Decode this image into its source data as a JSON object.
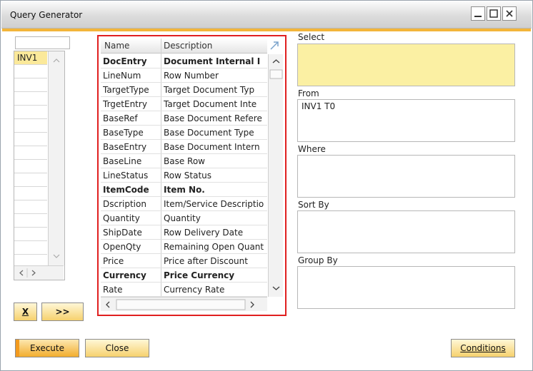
{
  "window": {
    "title": "Query Generator"
  },
  "tables": {
    "items": [
      "INV1"
    ]
  },
  "grid": {
    "headers": {
      "name": "Name",
      "description": "Description"
    },
    "rows": [
      {
        "name": "DocEntry",
        "description": "Document Internal I",
        "bold": true
      },
      {
        "name": "LineNum",
        "description": "Row Number",
        "bold": false
      },
      {
        "name": "TargetType",
        "description": "Target Document Typ",
        "bold": false
      },
      {
        "name": "TrgetEntry",
        "description": "Target Document Inte",
        "bold": false
      },
      {
        "name": "BaseRef",
        "description": "Base Document Refere",
        "bold": false
      },
      {
        "name": "BaseType",
        "description": "Base Document Type",
        "bold": false
      },
      {
        "name": "BaseEntry",
        "description": "Base Document Intern",
        "bold": false
      },
      {
        "name": "BaseLine",
        "description": "Base Row",
        "bold": false
      },
      {
        "name": "LineStatus",
        "description": "Row Status",
        "bold": false
      },
      {
        "name": "ItemCode",
        "description": "Item No.",
        "bold": true
      },
      {
        "name": "Dscription",
        "description": "Item/Service Descriptio",
        "bold": false
      },
      {
        "name": "Quantity",
        "description": "Quantity",
        "bold": false
      },
      {
        "name": "ShipDate",
        "description": "Row Delivery Date",
        "bold": false
      },
      {
        "name": "OpenQty",
        "description": "Remaining Open Quant",
        "bold": false
      },
      {
        "name": "Price",
        "description": "Price after Discount",
        "bold": false
      },
      {
        "name": "Currency",
        "description": "Price Currency",
        "bold": true
      },
      {
        "name": "Rate",
        "description": "Currency Rate",
        "bold": false
      }
    ]
  },
  "sections": {
    "select": {
      "label": "Select",
      "value": ""
    },
    "from": {
      "label": "From",
      "value": "INV1 T0"
    },
    "where": {
      "label": "Where",
      "value": ""
    },
    "sort_by": {
      "label": "Sort By",
      "value": ""
    },
    "group_by": {
      "label": "Group By",
      "value": ""
    }
  },
  "buttons": {
    "remove": "X",
    "move": ">>",
    "execute": "Execute",
    "close": "Close",
    "conditions": "Conditions"
  },
  "colors": {
    "accent": "#f3b53a",
    "highlight": "#fbe99a",
    "select_box": "#fbf0a3",
    "grid_outline": "#e02020"
  }
}
